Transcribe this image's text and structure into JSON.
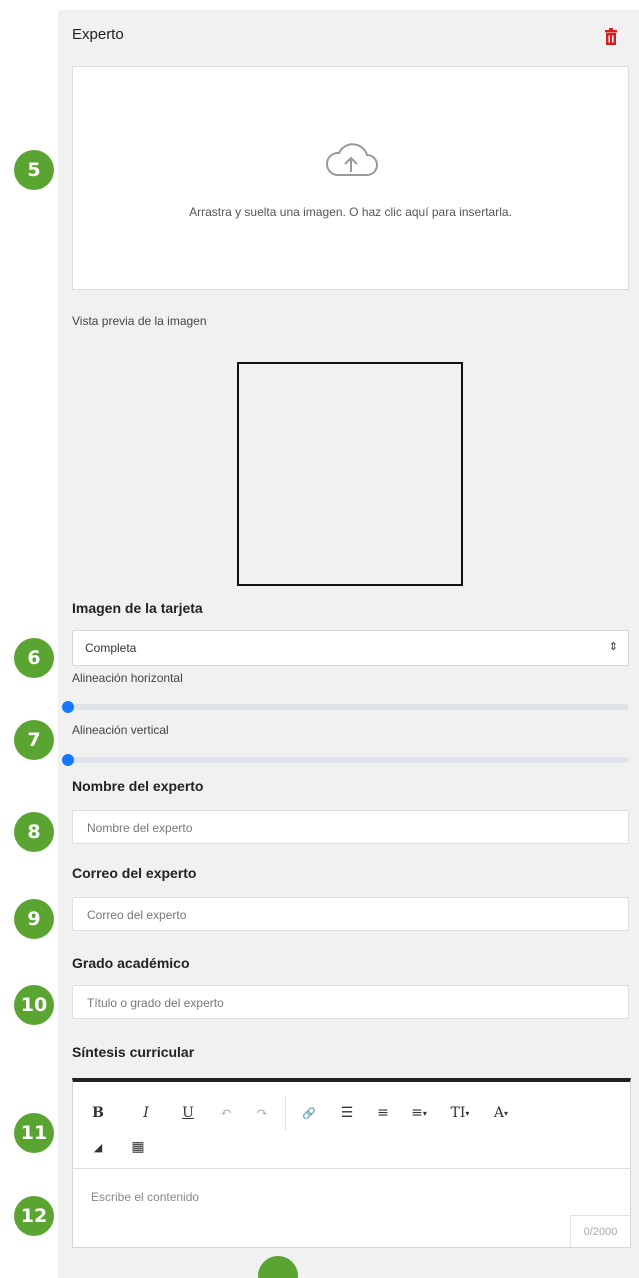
{
  "section": {
    "title": "Experto"
  },
  "upload": {
    "text": "Arrastra y suelta una imagen. O haz clic aquí para insertarla."
  },
  "preview": {
    "label": "Vista previa de la imagen"
  },
  "card_image": {
    "label": "Imagen de la tarjeta",
    "selected": "Completa",
    "caret": "⇕"
  },
  "alignment": {
    "horizontal_label": "Alineación horizontal",
    "vertical_label": "Alineación vertical",
    "horizontal_value": 0,
    "vertical_value": 0
  },
  "fields": {
    "name": {
      "label": "Nombre del experto",
      "placeholder": "Nombre del experto"
    },
    "email": {
      "label": "Correo del experto",
      "placeholder": "Correo del experto"
    },
    "degree": {
      "label": "Grado académico",
      "placeholder": "Título o grado del experto"
    },
    "synthesis": {
      "label": "Síntesis curricular"
    }
  },
  "editor": {
    "placeholder": "Escribe el contenido",
    "counter": "0/2000",
    "toolbar": {
      "bold": "B",
      "italic": "I",
      "underline": "U",
      "undo": "↶",
      "redo": "↷",
      "link": "🔗",
      "ordered_list": "☰",
      "unordered_list": "≡",
      "align": "≡",
      "text_size": "TI",
      "font_color": "A",
      "eraser": "◢",
      "table": "▦"
    }
  },
  "badges": [
    "5",
    "6",
    "7",
    "8",
    "9",
    "10",
    "11",
    "12"
  ],
  "colors": {
    "badge": "#5aa431",
    "slider_thumb": "#1677ff",
    "delete_icon": "#d62020"
  }
}
